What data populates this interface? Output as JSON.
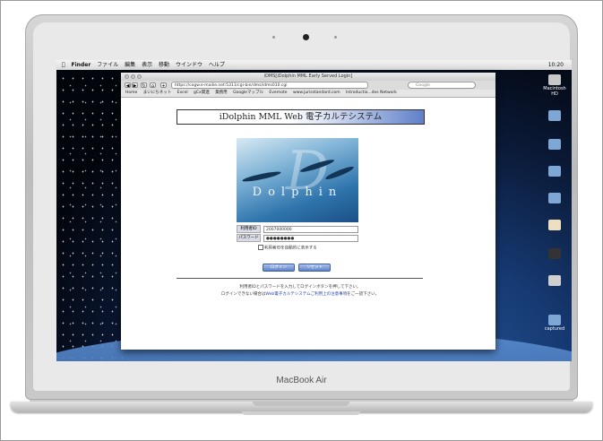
{
  "laptop": {
    "brand": "MacBook Air"
  },
  "menubar": {
    "items": [
      "Finder",
      "ファイル",
      "編集",
      "表示",
      "移動",
      "ウインドウ",
      "ヘルプ"
    ],
    "clock": "10:20"
  },
  "desktop_icons": [
    {
      "label": "Macintosh HD",
      "color": "#c8c8c8"
    },
    {
      "label": "",
      "color": "#7fa7d6"
    },
    {
      "label": "",
      "color": "#7fa7d6"
    },
    {
      "label": "",
      "color": "#7fa7d6"
    },
    {
      "label": "",
      "color": "#7fa7d6"
    },
    {
      "label": "",
      "color": "#ece0c0"
    },
    {
      "label": "",
      "color": "#333333"
    },
    {
      "label": "",
      "color": "#d0d0d0"
    },
    {
      "label": "captured",
      "color": "#7fa7d6"
    }
  ],
  "browser": {
    "title": "iDMS[iDolphin MML Early Served Login]",
    "url": "https://cogw.e-mailie.net:5311/cgi-bin/dms/idms010.cgi",
    "search_placeholder": "Google",
    "bookmarks": [
      "Home",
      "まいにちネット",
      "Excel",
      "gCx関連",
      "業務用",
      "Googleマップル",
      "Evernote",
      "www.jurisstandard.com",
      "Introductio...des Network"
    ]
  },
  "page": {
    "title": "iDolphin MML Web 電子カルテシステム",
    "logo_text": "Dolphin",
    "user_label": "利用者ID",
    "user_value": "2007000000",
    "password_label": "パスワード",
    "password_value": "●●●●●●●●",
    "remember_label": "利用者IDを自動的に表示する",
    "login_button": "ログイン",
    "reset_button": "リセット",
    "note1": "利用者IDとパスワードを入力してログインボタンを押して下さい。",
    "note2_prefix": "ログインできない場合は",
    "note2_link": "Web電子カルテシステムご利用上の注意事項",
    "note2_suffix": "をご一読下さい。"
  }
}
